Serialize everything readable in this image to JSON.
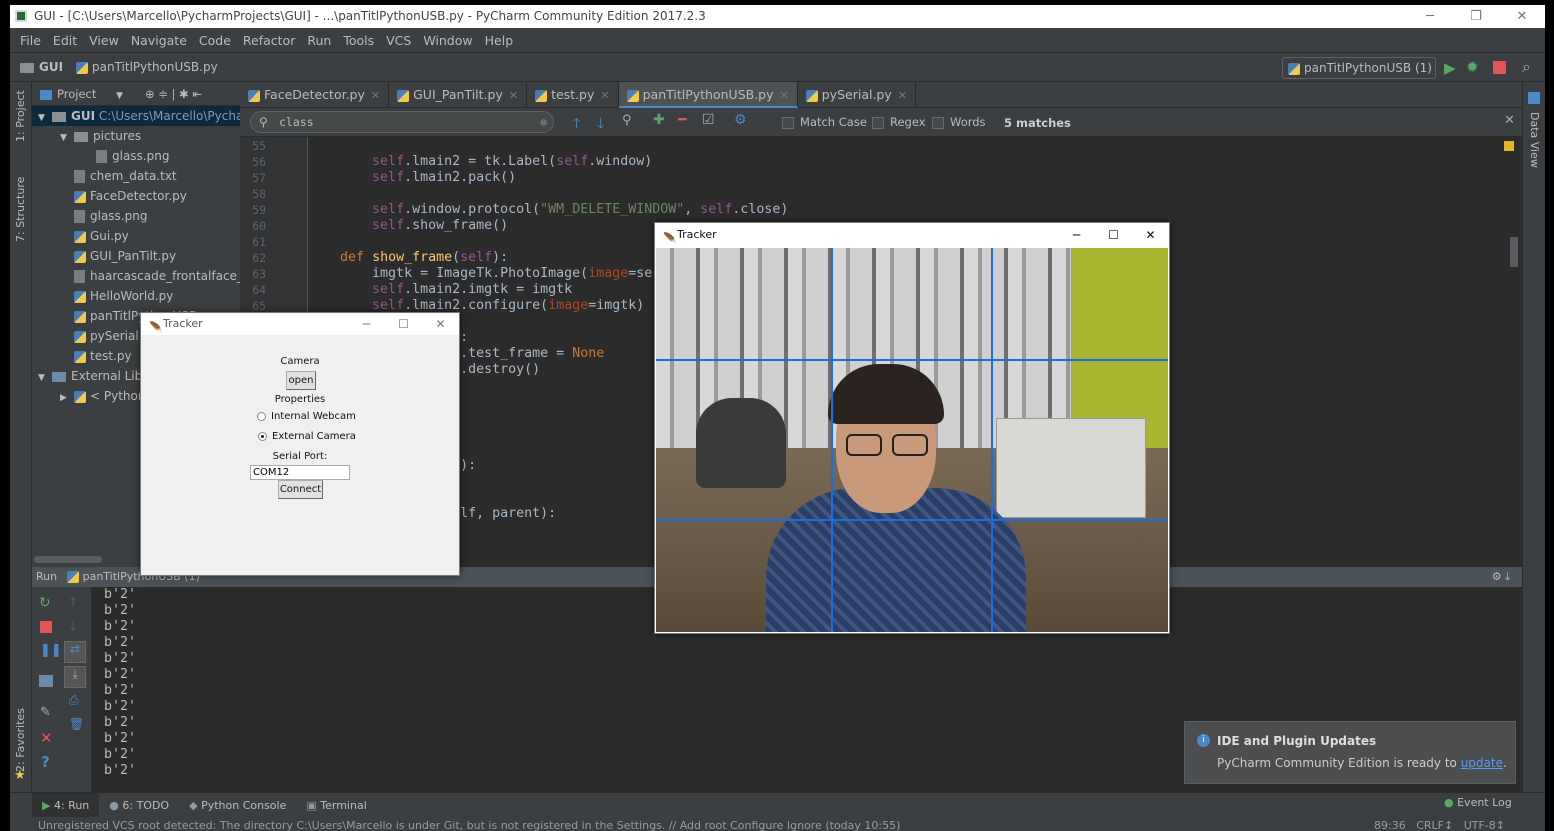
{
  "window": {
    "title": "GUI - [C:\\Users\\Marcello\\PycharmProjects\\GUI] - ...\\panTitlPythonUSB.py - PyCharm Community Edition 2017.2.3",
    "min": "─",
    "max": "❐",
    "close": "✕"
  },
  "menu": [
    "File",
    "Edit",
    "View",
    "Navigate",
    "Code",
    "Refactor",
    "Run",
    "Tools",
    "VCS",
    "Window",
    "Help"
  ],
  "navbar": {
    "project": "GUI",
    "file": "panTitlPythonUSB.py",
    "run_config": "panTitlPythonUSB (1)",
    "run_icon": "play-icon",
    "debug_icon": "bug-icon",
    "stop_icon": "stop-icon",
    "search_icon": "search-icon"
  },
  "left_strip": {
    "project": "1: Project",
    "structure": "7: Structure",
    "favorites": "2: Favorites"
  },
  "right_strip": {
    "data_view": "Data View"
  },
  "project_panel": {
    "header": "Project",
    "items": [
      {
        "label": "GUI",
        "path": "C:\\Users\\Marcello\\Pycharm",
        "type": "folder",
        "depth": 0,
        "open": true
      },
      {
        "label": "pictures",
        "type": "folder",
        "depth": 1,
        "open": true
      },
      {
        "label": "glass.png",
        "type": "image",
        "depth": 2
      },
      {
        "label": "chem_data.txt",
        "type": "text",
        "depth": 1
      },
      {
        "label": "FaceDetector.py",
        "type": "py",
        "depth": 1
      },
      {
        "label": "glass.png",
        "type": "image",
        "depth": 1
      },
      {
        "label": "Gui.py",
        "type": "py",
        "depth": 1
      },
      {
        "label": "GUI_PanTilt.py",
        "type": "py",
        "depth": 1
      },
      {
        "label": "haarcascade_frontalface_de",
        "type": "xml",
        "depth": 1
      },
      {
        "label": "HelloWorld.py",
        "type": "py",
        "depth": 1
      },
      {
        "label": "panTitlPythonUSB.py",
        "type": "py",
        "depth": 1
      },
      {
        "label": "pySerial.py",
        "type": "py",
        "depth": 1
      },
      {
        "label": "test.py",
        "type": "py",
        "depth": 1
      },
      {
        "label": "External Libraries",
        "type": "lib",
        "depth": 0,
        "open": true
      },
      {
        "label": "< Python",
        "type": "py",
        "depth": 1,
        "open": false
      }
    ]
  },
  "tabs": [
    {
      "label": "FaceDetector.py"
    },
    {
      "label": "GUI_PanTilt.py"
    },
    {
      "label": "test.py"
    },
    {
      "label": "panTitlPythonUSB.py",
      "active": true
    },
    {
      "label": "pySerial.py"
    }
  ],
  "find": {
    "query": "class",
    "match_case": "Match Case",
    "regex": "Regex",
    "words": "Words",
    "matches": "5 matches"
  },
  "editor": {
    "lines": [
      {
        "n": "55",
        "s": []
      },
      {
        "n": "56",
        "s": [
          [
            "",
            "        "
          ],
          [
            "self",
            "self"
          ],
          [
            "",
            ".lmain2 = tk.Label("
          ],
          [
            "self",
            "self"
          ],
          [
            "",
            ".window)"
          ]
        ]
      },
      {
        "n": "57",
        "s": [
          [
            "",
            "        "
          ],
          [
            "self",
            "self"
          ],
          [
            "",
            ".lmain2.pack()"
          ]
        ]
      },
      {
        "n": "58",
        "s": []
      },
      {
        "n": "59",
        "s": [
          [
            "",
            "        "
          ],
          [
            "self",
            "self"
          ],
          [
            "",
            ".window.protocol("
          ],
          [
            "str",
            "\"WM_DELETE_WINDOW\""
          ],
          [
            "",
            ", "
          ],
          [
            "self",
            "self"
          ],
          [
            "",
            ".close)"
          ]
        ]
      },
      {
        "n": "60",
        "s": [
          [
            "",
            "        "
          ],
          [
            "self",
            "self"
          ],
          [
            "",
            ".show_frame()"
          ]
        ]
      },
      {
        "n": "61",
        "s": []
      },
      {
        "n": "62",
        "s": [
          [
            "",
            "    "
          ],
          [
            "kw",
            "def "
          ],
          [
            "fn",
            "show_frame"
          ],
          [
            "",
            "("
          ],
          [
            "self",
            "self"
          ],
          [
            "",
            "):"
          ]
        ]
      },
      {
        "n": "63",
        "s": [
          [
            "",
            "        imgtk = ImageTk.PhotoImage("
          ],
          [
            "arg",
            "image"
          ],
          [
            "",
            "=se"
          ]
        ]
      },
      {
        "n": "64",
        "s": [
          [
            "",
            "        "
          ],
          [
            "self",
            "self"
          ],
          [
            "",
            ".lmain2.imgtk = imgtk"
          ]
        ]
      },
      {
        "n": "65",
        "s": [
          [
            "",
            "        "
          ],
          [
            "self",
            "self"
          ],
          [
            "",
            ".lmain2.configure("
          ],
          [
            "arg",
            "image"
          ],
          [
            "",
            "=imgtk)"
          ]
        ]
      },
      {
        "n": "66",
        "s": []
      },
      {
        "n": "67",
        "s": [
          [
            "",
            "                   :"
          ]
        ]
      },
      {
        "n": "68",
        "s": [
          [
            "",
            "                   .test_frame = "
          ],
          [
            "kw",
            "None"
          ]
        ]
      },
      {
        "n": "69",
        "s": [
          [
            "",
            "                   .destroy()"
          ]
        ]
      },
      {
        "n": "70",
        "s": []
      },
      {
        "n": "71",
        "s": []
      },
      {
        "n": "72",
        "s": []
      },
      {
        "n": "73",
        "s": []
      },
      {
        "n": "74",
        "s": []
      },
      {
        "n": "75",
        "s": [
          [
            "",
            "                   ):"
          ]
        ]
      },
      {
        "n": "76",
        "s": []
      },
      {
        "n": "77",
        "s": []
      },
      {
        "n": "78",
        "s": [
          [
            "",
            "                   lf, parent):"
          ]
        ]
      }
    ]
  },
  "run": {
    "label": "Run",
    "config": "panTitlPythonUSB (1)",
    "output": [
      "b'2'",
      "b'2'",
      "b'2'",
      "b'2'",
      "b'2'",
      "b'2'",
      "b'2'",
      "b'2'",
      "b'2'",
      "b'2'",
      "b'2'",
      "b'2'"
    ]
  },
  "bottom_tabs": [
    "4: Run",
    "6: TODO",
    "Python Console",
    "Terminal"
  ],
  "event_log": "Event Log",
  "status": {
    "message": "Unregistered VCS root detected: The directory C:\\Users\\Marcello is under Git, but is not registered in the Settings. // Add root  Configure  Ignore (today 10:55)",
    "position": "89:36",
    "line_sep": "CRLF↕",
    "encoding": "UTF-8↕"
  },
  "tracker_small": {
    "title": "Tracker",
    "camera": "Camera",
    "open": "open",
    "properties": "Properties",
    "internal": "Internal Webcam",
    "external": "External Camera",
    "selected": "External Camera",
    "serial_label": "Serial Port:",
    "serial_value": "COM12",
    "connect": "Connect"
  },
  "tracker_video": {
    "title": "Tracker",
    "grid": "3x3",
    "grid_color": "#1a6fe0"
  },
  "notification": {
    "title": "IDE and Plugin Updates",
    "text": "PyCharm Community Edition is ready to ",
    "link": "update",
    "suffix": "."
  }
}
